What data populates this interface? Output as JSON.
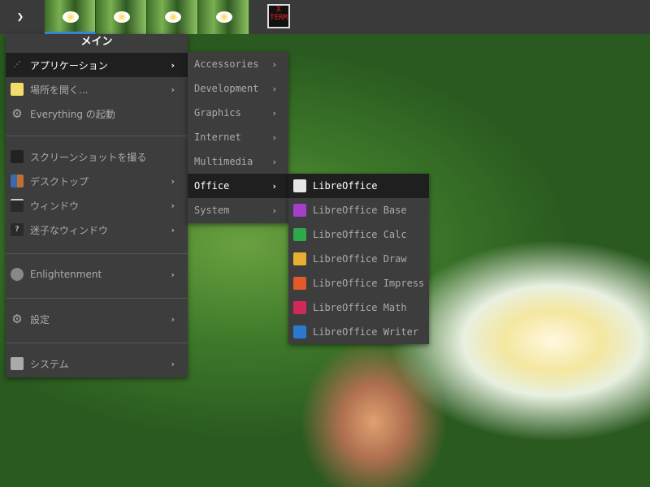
{
  "topbar": {
    "menu_icon": "chevron-down-icon",
    "desktops": 4,
    "active_desktop": 1,
    "xterm_label": "X TERM"
  },
  "main_menu": {
    "title": "メイン",
    "items": [
      {
        "label": "アプリケーション",
        "icon": "applications-icon",
        "submenu": true
      },
      {
        "label": "場所を開く...",
        "icon": "folder-icon",
        "submenu": true
      },
      {
        "label": "Everything の起動",
        "icon": "gear-icon",
        "submenu": false
      },
      {
        "label": "スクリーンショットを撮る",
        "icon": "camera-icon",
        "submenu": false
      },
      {
        "label": "デスクトップ",
        "icon": "desktop-icon",
        "submenu": true
      },
      {
        "label": "ウィンドウ",
        "icon": "window-icon",
        "submenu": true
      },
      {
        "label": "迷子なウィンドウ",
        "icon": "lost-window-icon",
        "submenu": true
      },
      {
        "label": "Enlightenment",
        "icon": "enlightenment-icon",
        "submenu": true
      },
      {
        "label": "設定",
        "icon": "gear-icon",
        "submenu": true
      },
      {
        "label": "システム",
        "icon": "monitor-icon",
        "submenu": true
      }
    ]
  },
  "categories": [
    "Accessories",
    "Development",
    "Graphics",
    "Internet",
    "Multimedia",
    "Office",
    "System"
  ],
  "office": [
    "LibreOffice",
    "LibreOffice Base",
    "LibreOffice Calc",
    "LibreOffice Draw",
    "LibreOffice Impress",
    "LibreOffice Math",
    "LibreOffice Writer"
  ],
  "office_colors": [
    "#e6e6e6",
    "#a43fc8",
    "#2ea84a",
    "#e8b030",
    "#e05a2a",
    "#d02a5a",
    "#2a7ad0"
  ]
}
